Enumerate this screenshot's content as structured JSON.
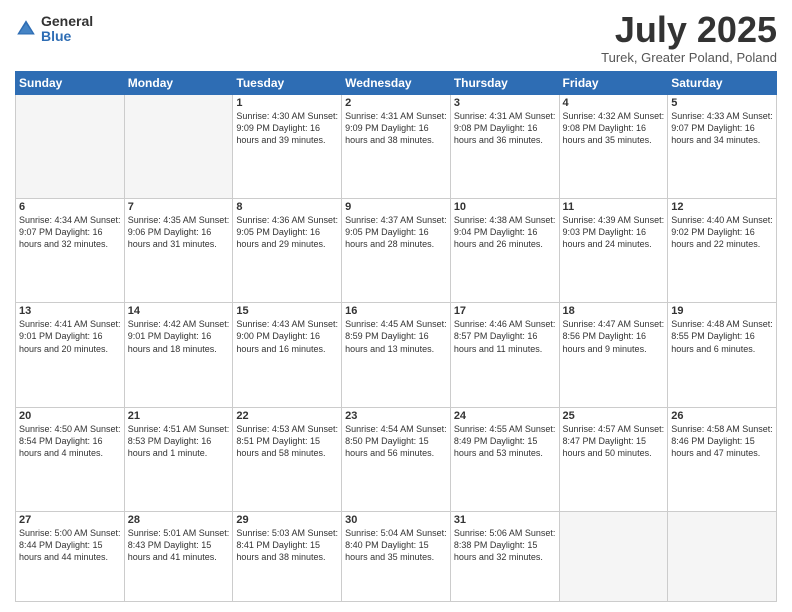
{
  "logo": {
    "general": "General",
    "blue": "Blue"
  },
  "title": "July 2025",
  "location": "Turek, Greater Poland, Poland",
  "days_of_week": [
    "Sunday",
    "Monday",
    "Tuesday",
    "Wednesday",
    "Thursday",
    "Friday",
    "Saturday"
  ],
  "weeks": [
    [
      {
        "num": "",
        "info": "",
        "empty": true
      },
      {
        "num": "",
        "info": "",
        "empty": true
      },
      {
        "num": "1",
        "info": "Sunrise: 4:30 AM\nSunset: 9:09 PM\nDaylight: 16 hours\nand 39 minutes."
      },
      {
        "num": "2",
        "info": "Sunrise: 4:31 AM\nSunset: 9:09 PM\nDaylight: 16 hours\nand 38 minutes."
      },
      {
        "num": "3",
        "info": "Sunrise: 4:31 AM\nSunset: 9:08 PM\nDaylight: 16 hours\nand 36 minutes."
      },
      {
        "num": "4",
        "info": "Sunrise: 4:32 AM\nSunset: 9:08 PM\nDaylight: 16 hours\nand 35 minutes."
      },
      {
        "num": "5",
        "info": "Sunrise: 4:33 AM\nSunset: 9:07 PM\nDaylight: 16 hours\nand 34 minutes."
      }
    ],
    [
      {
        "num": "6",
        "info": "Sunrise: 4:34 AM\nSunset: 9:07 PM\nDaylight: 16 hours\nand 32 minutes."
      },
      {
        "num": "7",
        "info": "Sunrise: 4:35 AM\nSunset: 9:06 PM\nDaylight: 16 hours\nand 31 minutes."
      },
      {
        "num": "8",
        "info": "Sunrise: 4:36 AM\nSunset: 9:05 PM\nDaylight: 16 hours\nand 29 minutes."
      },
      {
        "num": "9",
        "info": "Sunrise: 4:37 AM\nSunset: 9:05 PM\nDaylight: 16 hours\nand 28 minutes."
      },
      {
        "num": "10",
        "info": "Sunrise: 4:38 AM\nSunset: 9:04 PM\nDaylight: 16 hours\nand 26 minutes."
      },
      {
        "num": "11",
        "info": "Sunrise: 4:39 AM\nSunset: 9:03 PM\nDaylight: 16 hours\nand 24 minutes."
      },
      {
        "num": "12",
        "info": "Sunrise: 4:40 AM\nSunset: 9:02 PM\nDaylight: 16 hours\nand 22 minutes."
      }
    ],
    [
      {
        "num": "13",
        "info": "Sunrise: 4:41 AM\nSunset: 9:01 PM\nDaylight: 16 hours\nand 20 minutes."
      },
      {
        "num": "14",
        "info": "Sunrise: 4:42 AM\nSunset: 9:01 PM\nDaylight: 16 hours\nand 18 minutes."
      },
      {
        "num": "15",
        "info": "Sunrise: 4:43 AM\nSunset: 9:00 PM\nDaylight: 16 hours\nand 16 minutes."
      },
      {
        "num": "16",
        "info": "Sunrise: 4:45 AM\nSunset: 8:59 PM\nDaylight: 16 hours\nand 13 minutes."
      },
      {
        "num": "17",
        "info": "Sunrise: 4:46 AM\nSunset: 8:57 PM\nDaylight: 16 hours\nand 11 minutes."
      },
      {
        "num": "18",
        "info": "Sunrise: 4:47 AM\nSunset: 8:56 PM\nDaylight: 16 hours\nand 9 minutes."
      },
      {
        "num": "19",
        "info": "Sunrise: 4:48 AM\nSunset: 8:55 PM\nDaylight: 16 hours\nand 6 minutes."
      }
    ],
    [
      {
        "num": "20",
        "info": "Sunrise: 4:50 AM\nSunset: 8:54 PM\nDaylight: 16 hours\nand 4 minutes."
      },
      {
        "num": "21",
        "info": "Sunrise: 4:51 AM\nSunset: 8:53 PM\nDaylight: 16 hours\nand 1 minute."
      },
      {
        "num": "22",
        "info": "Sunrise: 4:53 AM\nSunset: 8:51 PM\nDaylight: 15 hours\nand 58 minutes."
      },
      {
        "num": "23",
        "info": "Sunrise: 4:54 AM\nSunset: 8:50 PM\nDaylight: 15 hours\nand 56 minutes."
      },
      {
        "num": "24",
        "info": "Sunrise: 4:55 AM\nSunset: 8:49 PM\nDaylight: 15 hours\nand 53 minutes."
      },
      {
        "num": "25",
        "info": "Sunrise: 4:57 AM\nSunset: 8:47 PM\nDaylight: 15 hours\nand 50 minutes."
      },
      {
        "num": "26",
        "info": "Sunrise: 4:58 AM\nSunset: 8:46 PM\nDaylight: 15 hours\nand 47 minutes."
      }
    ],
    [
      {
        "num": "27",
        "info": "Sunrise: 5:00 AM\nSunset: 8:44 PM\nDaylight: 15 hours\nand 44 minutes."
      },
      {
        "num": "28",
        "info": "Sunrise: 5:01 AM\nSunset: 8:43 PM\nDaylight: 15 hours\nand 41 minutes."
      },
      {
        "num": "29",
        "info": "Sunrise: 5:03 AM\nSunset: 8:41 PM\nDaylight: 15 hours\nand 38 minutes."
      },
      {
        "num": "30",
        "info": "Sunrise: 5:04 AM\nSunset: 8:40 PM\nDaylight: 15 hours\nand 35 minutes."
      },
      {
        "num": "31",
        "info": "Sunrise: 5:06 AM\nSunset: 8:38 PM\nDaylight: 15 hours\nand 32 minutes."
      },
      {
        "num": "",
        "info": "",
        "empty": true
      },
      {
        "num": "",
        "info": "",
        "empty": true
      }
    ]
  ]
}
